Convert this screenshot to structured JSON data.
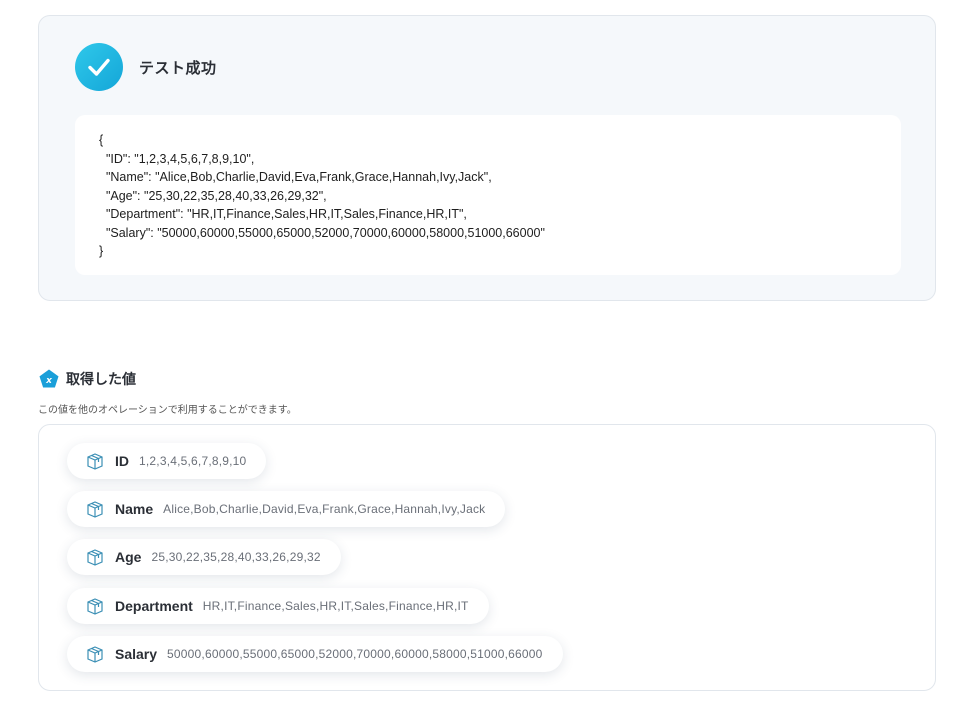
{
  "test_result": {
    "title": "テスト成功",
    "json_lines": [
      "{",
      "  \"ID\": \"1,2,3,4,5,6,7,8,9,10\",",
      "  \"Name\": \"Alice,Bob,Charlie,David,Eva,Frank,Grace,Hannah,Ivy,Jack\",",
      "  \"Age\": \"25,30,22,35,28,40,33,26,29,32\",",
      "  \"Department\": \"HR,IT,Finance,Sales,HR,IT,Sales,Finance,HR,IT\",",
      "  \"Salary\": \"50000,60000,55000,65000,52000,70000,60000,58000,51000,66000\"",
      "}"
    ]
  },
  "values_section": {
    "title": "取得した値",
    "description": "この値を他のオペレーションで利用することができます。",
    "items": [
      {
        "key": "ID",
        "value": "1,2,3,4,5,6,7,8,9,10"
      },
      {
        "key": "Name",
        "value": "Alice,Bob,Charlie,David,Eva,Frank,Grace,Hannah,Ivy,Jack"
      },
      {
        "key": "Age",
        "value": "25,30,22,35,28,40,33,26,29,32"
      },
      {
        "key": "Department",
        "value": "HR,IT,Finance,Sales,HR,IT,Sales,Finance,HR,IT"
      },
      {
        "key": "Salary",
        "value": "50000,60000,55000,65000,52000,70000,60000,58000,51000,66000"
      }
    ]
  },
  "icons": {
    "success": "check-circle-icon",
    "section": "variable-pentagon-icon",
    "item": "box-icon"
  },
  "colors": {
    "accent": "#1ab3e0",
    "card_bg": "#f5f8fb",
    "border": "#e1e6ec",
    "text": "#2b2f36",
    "muted": "#6a6f78"
  }
}
